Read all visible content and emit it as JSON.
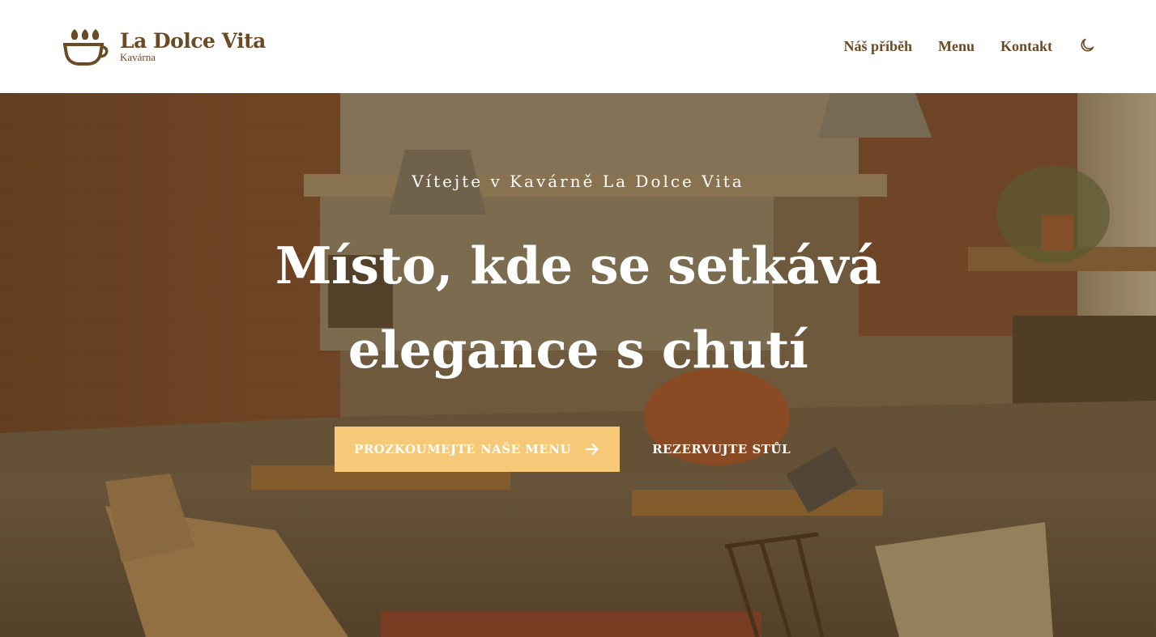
{
  "header": {
    "brand_name": "La Dolce Vita",
    "brand_subtitle": "Kavárna",
    "nav": [
      {
        "label": "Náš příběh"
      },
      {
        "label": "Menu"
      },
      {
        "label": "Kontakt"
      }
    ],
    "theme_toggle_icon": "moon-icon"
  },
  "hero": {
    "eyebrow": "Vítejte v Kavárně La Dolce Vita",
    "title_line1": "Místo, kde se setkává",
    "title_line2": "elegance s chutí",
    "primary_button": "Prozkoumejte naše menu",
    "primary_button_icon": "arrow-right-icon",
    "secondary_button": "Rezervujte stůl",
    "background_image": "cafe-interior-photo"
  },
  "colors": {
    "brand_brown": "#6b4a26",
    "accent_gold": "#f6c979",
    "header_bg": "#ffffff",
    "hero_text": "#ffffff"
  }
}
